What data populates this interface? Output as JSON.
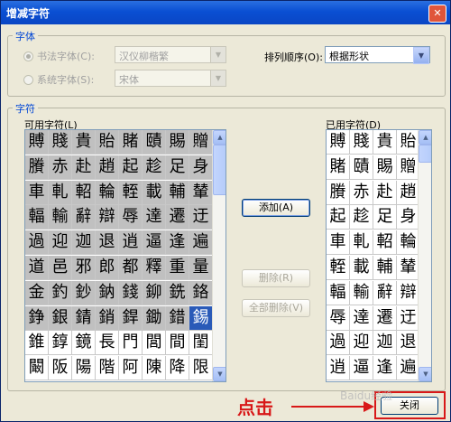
{
  "title": "增减字符",
  "font_group": {
    "label": "字体",
    "calligraphy_radio": "书法字体(C):",
    "calligraphy_value": "汉仪柳楷繁",
    "system_radio": "系统字体(S):",
    "system_value": "宋体",
    "sort_label": "排列顺序(O):",
    "sort_value": "根据形状"
  },
  "char_group": {
    "label": "字符"
  },
  "available": {
    "label": "可用字符(L)",
    "rows": [
      [
        "賻",
        "賤",
        "貴",
        "貽",
        "賭",
        "賾",
        "賜",
        "贈"
      ],
      [
        "賸",
        "赤",
        "赴",
        "趙",
        "起",
        "趁",
        "足",
        "身"
      ],
      [
        "車",
        "軋",
        "軺",
        "輪",
        "輊",
        "載",
        "輔",
        "輦"
      ],
      [
        "輻",
        "輸",
        "辭",
        "辯",
        "辱",
        "達",
        "遷",
        "迂"
      ],
      [
        "過",
        "迎",
        "迦",
        "退",
        "逍",
        "逼",
        "逢",
        "遍"
      ],
      [
        "道",
        "邑",
        "邪",
        "郎",
        "都",
        "釋",
        "重",
        "量"
      ],
      [
        "金",
        "釣",
        "鈔",
        "鈉",
        "錢",
        "鉚",
        "銑",
        "鉻"
      ],
      [
        "錚",
        "銀",
        "錆",
        "銷",
        "銲",
        "鋤",
        "錯",
        "錫"
      ],
      [
        "錐",
        "錞",
        "鏡",
        "長",
        "門",
        "閭",
        "間",
        "閨"
      ],
      [
        "闞",
        "阪",
        "陽",
        "階",
        "阿",
        "陳",
        "降",
        "限"
      ]
    ]
  },
  "used": {
    "label": "已用字符(D)",
    "rows": [
      [
        "賻",
        "賤",
        "貴",
        "貽"
      ],
      [
        "賭",
        "賾",
        "賜",
        "贈"
      ],
      [
        "賸",
        "赤",
        "赴",
        "趙"
      ],
      [
        "起",
        "趁",
        "足",
        "身"
      ],
      [
        "車",
        "軋",
        "軺",
        "輪"
      ],
      [
        "輊",
        "載",
        "輔",
        "輦"
      ],
      [
        "輻",
        "輸",
        "辭",
        "辯"
      ],
      [
        "辱",
        "達",
        "遷",
        "迂"
      ],
      [
        "過",
        "迎",
        "迦",
        "退"
      ],
      [
        "逍",
        "逼",
        "逢",
        "遍"
      ]
    ]
  },
  "buttons": {
    "add": "添加(A)",
    "delete": "删除(R)",
    "delete_all": "全部删除(V)",
    "close": "关闭"
  },
  "annotation": "点击",
  "watermark": "Baidu经验"
}
